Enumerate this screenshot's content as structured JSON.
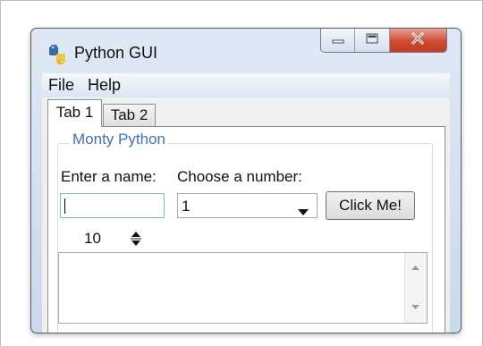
{
  "window": {
    "title": "Python GUI",
    "icon": "python-icon"
  },
  "caption_buttons": {
    "minimize": "minimize-icon",
    "maximize": "maximize-icon",
    "close": "close-icon"
  },
  "menu": {
    "items": [
      {
        "label": "File"
      },
      {
        "label": "Help"
      }
    ]
  },
  "tabs": [
    {
      "label": "Tab 1"
    },
    {
      "label": "Tab 2"
    }
  ],
  "active_tab": 0,
  "group": {
    "title": "Monty Python",
    "name_label": "Enter a name:",
    "number_label": "Choose a number:",
    "name_value": "",
    "combo_value": "1",
    "button_label": "Click Me!",
    "spin_value": "10"
  },
  "colors": {
    "group_title": "#3a6fd2",
    "close_button": "#c94a32",
    "focus_border": "#7eb4ea"
  }
}
